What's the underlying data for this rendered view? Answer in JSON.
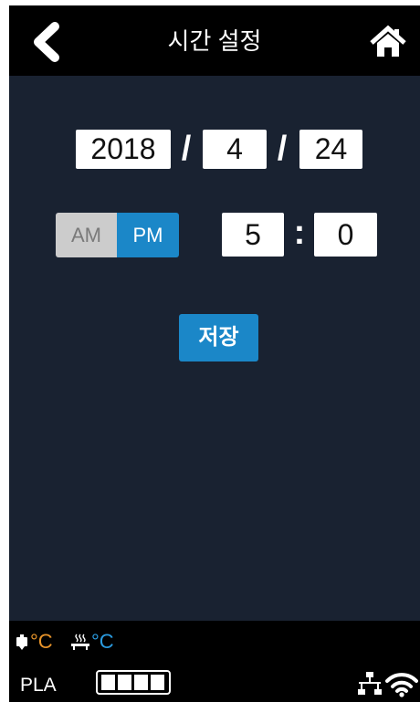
{
  "header": {
    "title": "시간 설정",
    "back_icon": "chevron-left-icon",
    "home_icon": "home-icon"
  },
  "date": {
    "year": "2018",
    "month": "4",
    "day": "24",
    "separator": "/"
  },
  "time": {
    "am_label": "AM",
    "pm_label": "PM",
    "selected_period": "PM",
    "hour": "5",
    "minute": "0",
    "separator": ":"
  },
  "save_label": "저장",
  "footer": {
    "nozzle_temp_unit": "°C",
    "bed_temp_unit": "°C",
    "material": "PLA",
    "battery_level": 1.0,
    "icons": [
      "nozzle-icon",
      "heated-bed-icon",
      "battery-icon",
      "ethernet-icon",
      "wifi-icon"
    ]
  },
  "colors": {
    "background": "#192231",
    "bar": "#000000",
    "accent": "#1b87c8",
    "nozzle_temp": "#e8942a",
    "bed_temp": "#2a9be0",
    "am_inactive": "#cccccc"
  }
}
